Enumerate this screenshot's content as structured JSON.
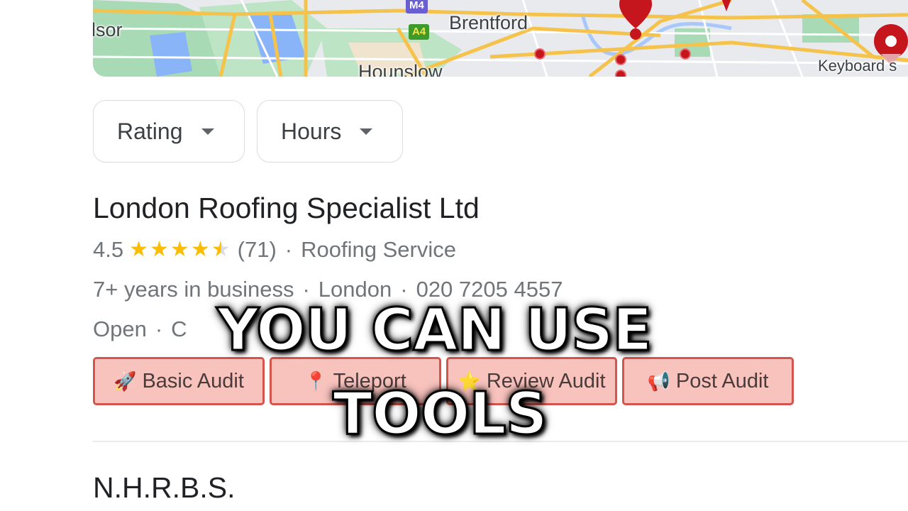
{
  "map": {
    "place_labels": [
      "lsor",
      "Brentford",
      "Hounslow"
    ],
    "road_shields": [
      {
        "label": "M4",
        "color": "#6a5fd0"
      },
      {
        "label": "A4",
        "color": "#3f9a2c"
      }
    ],
    "attribution": "Keyboard s",
    "marker_color": "#c5161d"
  },
  "filters": [
    {
      "label": "Rating",
      "icon": "caret-down-icon"
    },
    {
      "label": "Hours",
      "icon": "caret-down-icon"
    }
  ],
  "listing": {
    "name": "London Roofing Specialist Ltd",
    "rating": "4.5",
    "rating_value": 4.5,
    "rating_max": 5,
    "review_count": "(71)",
    "category": "Roofing Service",
    "years": "7+ years in business",
    "location": "London",
    "phone": "020 7205 4557",
    "status": "Open",
    "status_partial": "C",
    "separator": "·"
  },
  "tools": [
    {
      "label": "Basic Audit",
      "icon": "rocket-icon",
      "glyph": "🚀"
    },
    {
      "label": "Teleport",
      "icon": "map-pin-icon",
      "glyph": "📍"
    },
    {
      "label": "Review Audit",
      "icon": "star-icon",
      "glyph": "⭐"
    },
    {
      "label": "Post Audit",
      "icon": "megaphone-icon",
      "glyph": "📢"
    }
  ],
  "next_listing": {
    "name": "N.H.R.B.S."
  },
  "caption": {
    "line1": "YOU CAN USE",
    "line2": "TOOLS"
  },
  "colors": {
    "tool_bg": "#f8c2bd",
    "tool_border": "#d4554e",
    "star": "#fbbc04"
  }
}
